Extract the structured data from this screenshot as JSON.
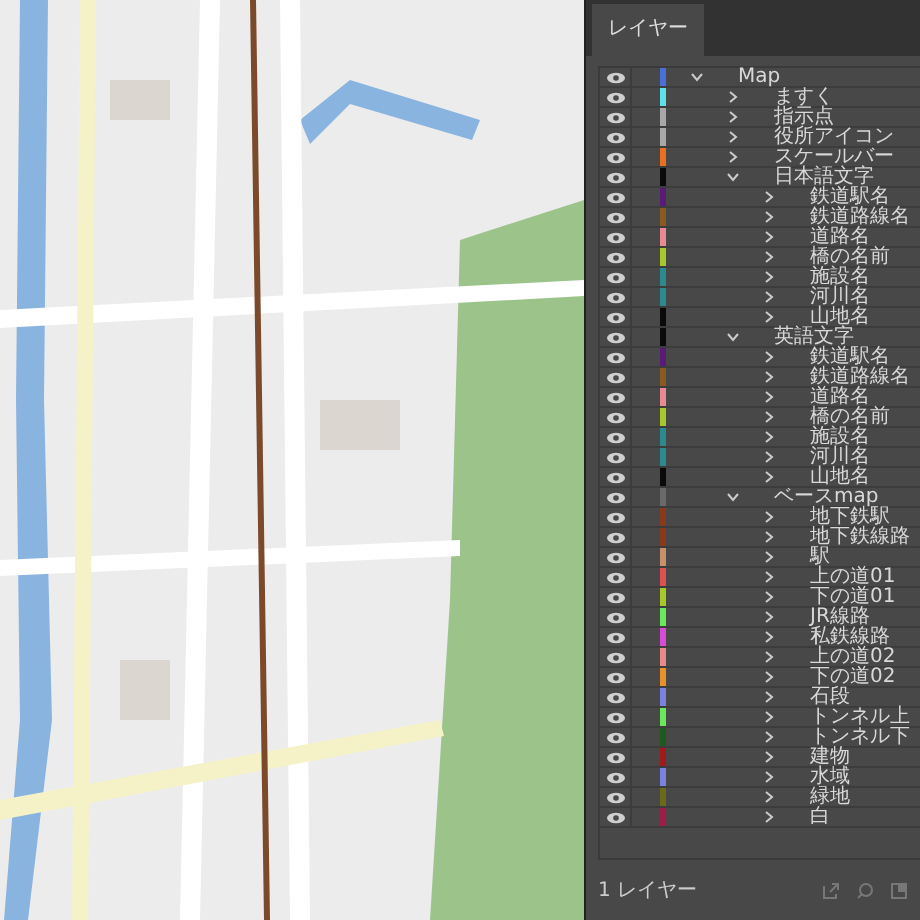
{
  "panel": {
    "tab": "レイヤー",
    "footer": "1 レイヤー"
  },
  "layers": [
    {
      "name": "Map",
      "color": "#4a6fd8",
      "expanded": true,
      "children": [
        {
          "name": "ますく",
          "color": "#5ee0e8",
          "expanded": false
        },
        {
          "name": "指示点",
          "color": "#a8a8a8",
          "expanded": false
        },
        {
          "name": "役所アイコン",
          "color": "#a8a8a8",
          "expanded": false
        },
        {
          "name": "スケールバー",
          "color": "#e8701e",
          "expanded": false
        },
        {
          "name": "日本語文字",
          "color": "#0a0a0a",
          "expanded": true,
          "children": [
            {
              "name": "鉄道駅名",
              "color": "#5a1a78",
              "expanded": false
            },
            {
              "name": "鉄道路線名",
              "color": "#8a5a1e",
              "expanded": false
            },
            {
              "name": "道路名",
              "color": "#e88a94",
              "expanded": false
            },
            {
              "name": "橋の名前",
              "color": "#a8c82a",
              "expanded": false
            },
            {
              "name": "施設名",
              "color": "#2a8a8e",
              "expanded": false
            },
            {
              "name": "河川名",
              "color": "#2a8a8e",
              "expanded": false
            },
            {
              "name": "山地名",
              "color": "#0a0a0a",
              "expanded": false
            }
          ]
        },
        {
          "name": "英語文字",
          "color": "#0a0a0a",
          "expanded": true,
          "children": [
            {
              "name": "鉄道駅名",
              "color": "#5a1a78",
              "expanded": false
            },
            {
              "name": "鉄道路線名",
              "color": "#8a5a1e",
              "expanded": false
            },
            {
              "name": "道路名",
              "color": "#e88a94",
              "expanded": false
            },
            {
              "name": "橋の名前",
              "color": "#a8c82a",
              "expanded": false
            },
            {
              "name": "施設名",
              "color": "#2a8a8e",
              "expanded": false
            },
            {
              "name": "河川名",
              "color": "#2a8a8e",
              "expanded": false
            },
            {
              "name": "山地名",
              "color": "#0a0a0a",
              "expanded": false
            }
          ]
        },
        {
          "name": "ベースmap",
          "color": "#6a6a6a",
          "expanded": true,
          "children": [
            {
              "name": "地下鉄駅",
              "color": "#8a3a1a",
              "expanded": false
            },
            {
              "name": "地下鉄線路",
              "color": "#8a3a1a",
              "expanded": false
            },
            {
              "name": "駅",
              "color": "#c8906a",
              "expanded": false
            },
            {
              "name": "上の道01",
              "color": "#e05050",
              "expanded": false
            },
            {
              "name": "下の道01",
              "color": "#a8c82a",
              "expanded": false
            },
            {
              "name": "JR線路",
              "color": "#6ae85a",
              "expanded": false
            },
            {
              "name": "私鉄線路",
              "color": "#d84ad8",
              "expanded": false
            },
            {
              "name": "上の道02",
              "color": "#e88a8a",
              "expanded": false
            },
            {
              "name": "下の道02",
              "color": "#e8902a",
              "expanded": false
            },
            {
              "name": "石段",
              "color": "#7a82e0",
              "expanded": false
            },
            {
              "name": "トンネル上",
              "color": "#6ae85a",
              "expanded": false
            },
            {
              "name": "トンネル下",
              "color": "#1e5a1e",
              "expanded": false
            },
            {
              "name": "建物",
              "color": "#a01a1a",
              "expanded": false
            },
            {
              "name": "水域",
              "color": "#7a82e0",
              "expanded": false
            },
            {
              "name": "緑地",
              "color": "#6a6a1a",
              "expanded": false
            },
            {
              "name": "白",
              "color": "#a01a4a",
              "expanded": false
            }
          ]
        }
      ]
    }
  ]
}
